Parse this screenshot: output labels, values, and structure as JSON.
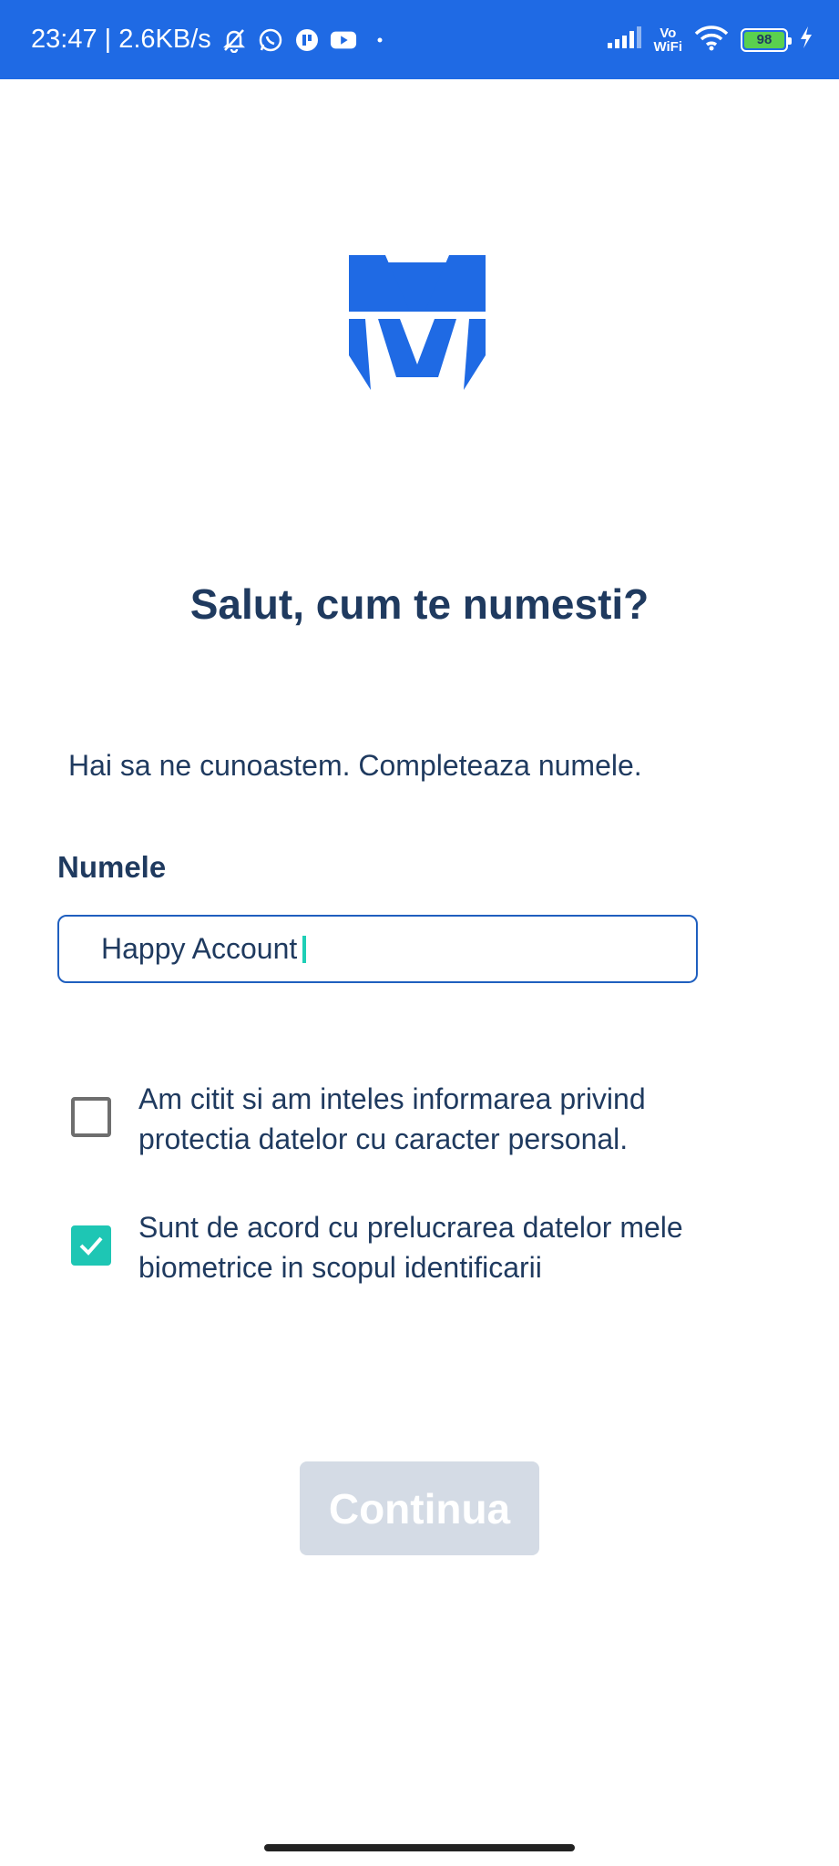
{
  "status_bar": {
    "time_speed": "23:47 | 2.6KB/s",
    "vowifi_top": "Vo",
    "vowifi_bottom": "WiFi",
    "battery": "98",
    "icons": [
      "mute-bell-icon",
      "whatsapp-icon",
      "app-icon",
      "youtube-icon",
      "dot-icon",
      "signal-icon",
      "wifi-icon",
      "battery-icon",
      "charging-icon"
    ]
  },
  "logo": {
    "name": "m-logo-icon"
  },
  "title": "Salut, cum te numesti?",
  "subtitle": "Hai sa ne cunoastem. Completeaza numele.",
  "name_field": {
    "label": "Numele",
    "value": "Happy Account"
  },
  "consents": [
    {
      "text_line1": "Am citit si am inteles informarea privind",
      "text_line2": "protectia datelor cu caracter personal.",
      "checked": false
    },
    {
      "text_line1": "Sunt de acord cu prelucrarea datelor mele",
      "text_line2": "biometrice in scopul identificarii",
      "checked": true
    }
  ],
  "continue_label": "Continua",
  "colors": {
    "status_bar": "#1f6ae4",
    "primary_text": "#1f3a5f",
    "accent": "#1ec6b4",
    "disabled_button": "#d4dbe5"
  }
}
